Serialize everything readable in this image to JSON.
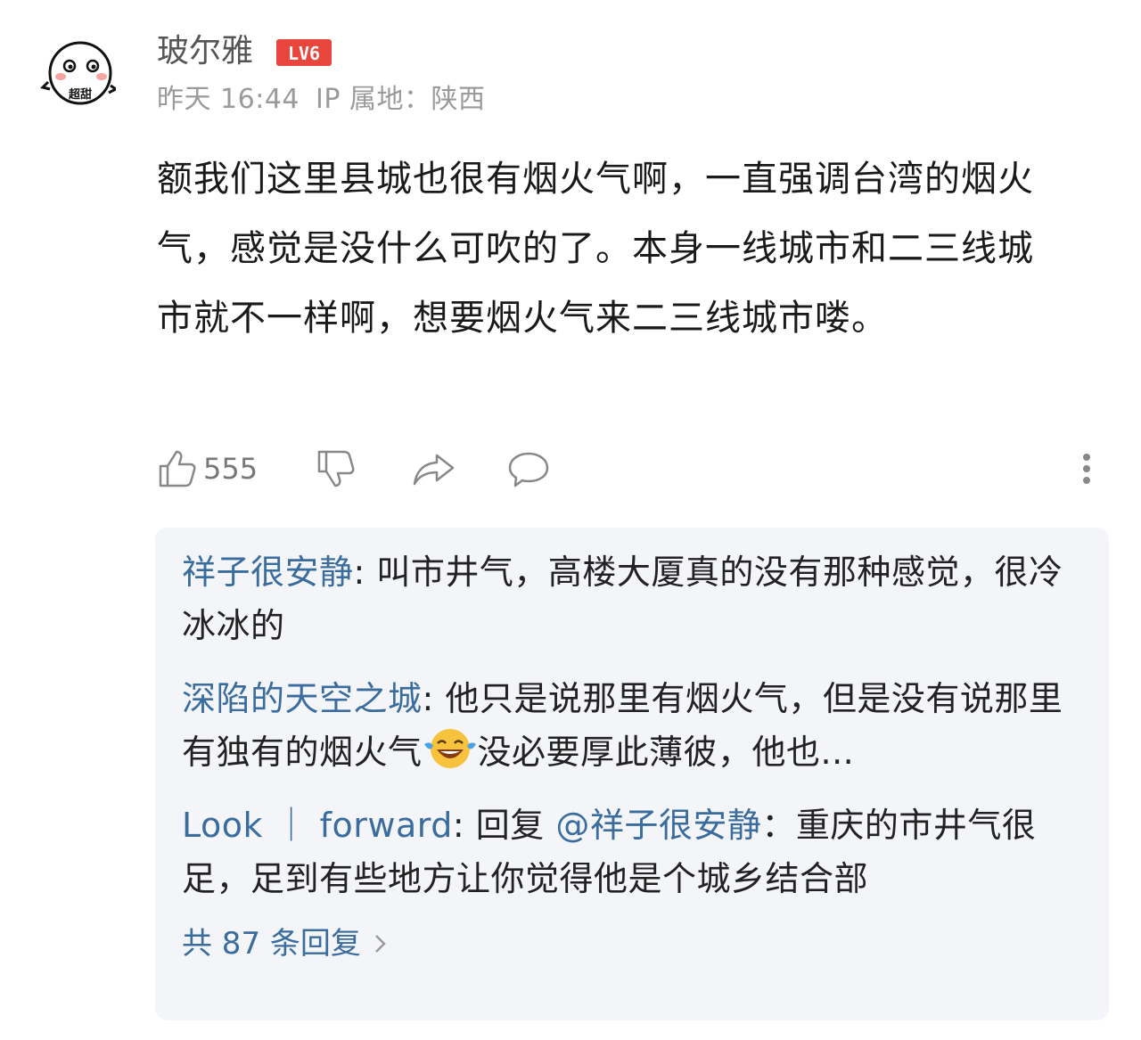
{
  "post": {
    "username": "玻尔雅",
    "level_badge": "LV6",
    "avatar_text": "超甜",
    "date": "昨天 16:44",
    "ip_location": "IP 属地：陕西",
    "content": "额我们这里县城也很有烟火气啊，一直强调台湾的烟火气，感觉是没什么可吹的了。本身一线城市和二三线城市就不一样啊，想要烟火气来二三线城市喽。"
  },
  "actions": {
    "like_count": "555",
    "icons": [
      "thumbs-up-icon",
      "thumbs-down-icon",
      "share-icon",
      "comment-icon",
      "more-icon"
    ]
  },
  "replies": {
    "items": [
      {
        "author": "祥子很安静",
        "separator": ": ",
        "text": "叫市井气，高楼大厦真的没有那种感觉，很冷冰冰的"
      },
      {
        "author": "深陷的天空之城",
        "separator": ": ",
        "text_before_emoji": "他只是说那里有烟火气，但是没有说那里有独有的烟火气",
        "emoji": "laughing-tears-emoji",
        "text_after_emoji": "没必要厚此薄彼，他也..."
      },
      {
        "author": "Look ｜ forward",
        "separator": ": ",
        "reply_prefix": "回复 ",
        "mention": "@祥子很安静",
        "text": "：重庆的市井气很足，足到有些地方让你觉得他是个城乡结合部"
      }
    ],
    "total_label": "共 87 条回复",
    "link_color": "#3a6d9e",
    "panel_color": "#f4f5f8"
  },
  "colors": {
    "badge_red": "#e8453c",
    "meta_gray": "#9a9a9a",
    "text": "#1a1a1a"
  }
}
